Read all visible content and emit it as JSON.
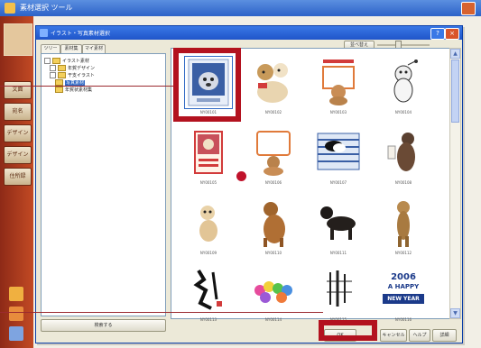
{
  "app": {
    "title": "素材選択 ツール",
    "strip_buttons": [
      "文面",
      "宛名",
      "デザイン",
      "デザイン",
      "住所録"
    ]
  },
  "dialog": {
    "title": "イラスト・写真素材選択",
    "close_label": "×",
    "help_label": "?",
    "tabs": [
      "ツリー",
      "素材集",
      "マイ素材"
    ],
    "tree": [
      {
        "label": "イラスト素材",
        "selected": false
      },
      {
        "label": "年賀デザイン",
        "selected": false
      },
      {
        "label": "干支イラスト",
        "selected": false
      },
      {
        "label": "写真素材",
        "selected": true
      },
      {
        "label": "年賀状素材集",
        "selected": false
      }
    ],
    "tree_button": "検索する",
    "sort_button": "並べ替え",
    "thumbnails": [
      {
        "caption": "NY00101",
        "icon": "dog-card-icon"
      },
      {
        "caption": "NY00102",
        "icon": "dogs-pair-icon"
      },
      {
        "caption": "NY00103",
        "icon": "dog-sign-icon"
      },
      {
        "caption": "NY00104",
        "icon": "puppy-icon"
      },
      {
        "caption": "NY00105",
        "icon": "framed-dog-icon"
      },
      {
        "caption": "NY00106",
        "icon": "dog-board-icon"
      },
      {
        "caption": "NY00107",
        "icon": "striped-card-icon"
      },
      {
        "caption": "NY00108",
        "icon": "sitting-dog-icon"
      },
      {
        "caption": "NY00109",
        "icon": "small-dog-icon"
      },
      {
        "caption": "NY00110",
        "icon": "brown-dog-icon"
      },
      {
        "caption": "NY00111",
        "icon": "dachshund-icon"
      },
      {
        "caption": "NY00112",
        "icon": "standing-dog-icon"
      },
      {
        "caption": "NY00113",
        "icon": "calligraphy-icon"
      },
      {
        "caption": "NY00114",
        "icon": "balloons-icon"
      },
      {
        "caption": "NY00115",
        "icon": "brush-text-icon"
      },
      {
        "caption": "NY00116",
        "icon": "happy-new-year-icon"
      }
    ],
    "buttons": [
      "OK",
      "キャンセル",
      "ヘルプ",
      "詳細"
    ],
    "happy_text": [
      "2006",
      "A HAPPY",
      "NEW YEAR"
    ]
  },
  "colors": {
    "highlight": "#b3121f",
    "strip": "#b03f20",
    "title_bar": "#2c62c8"
  }
}
